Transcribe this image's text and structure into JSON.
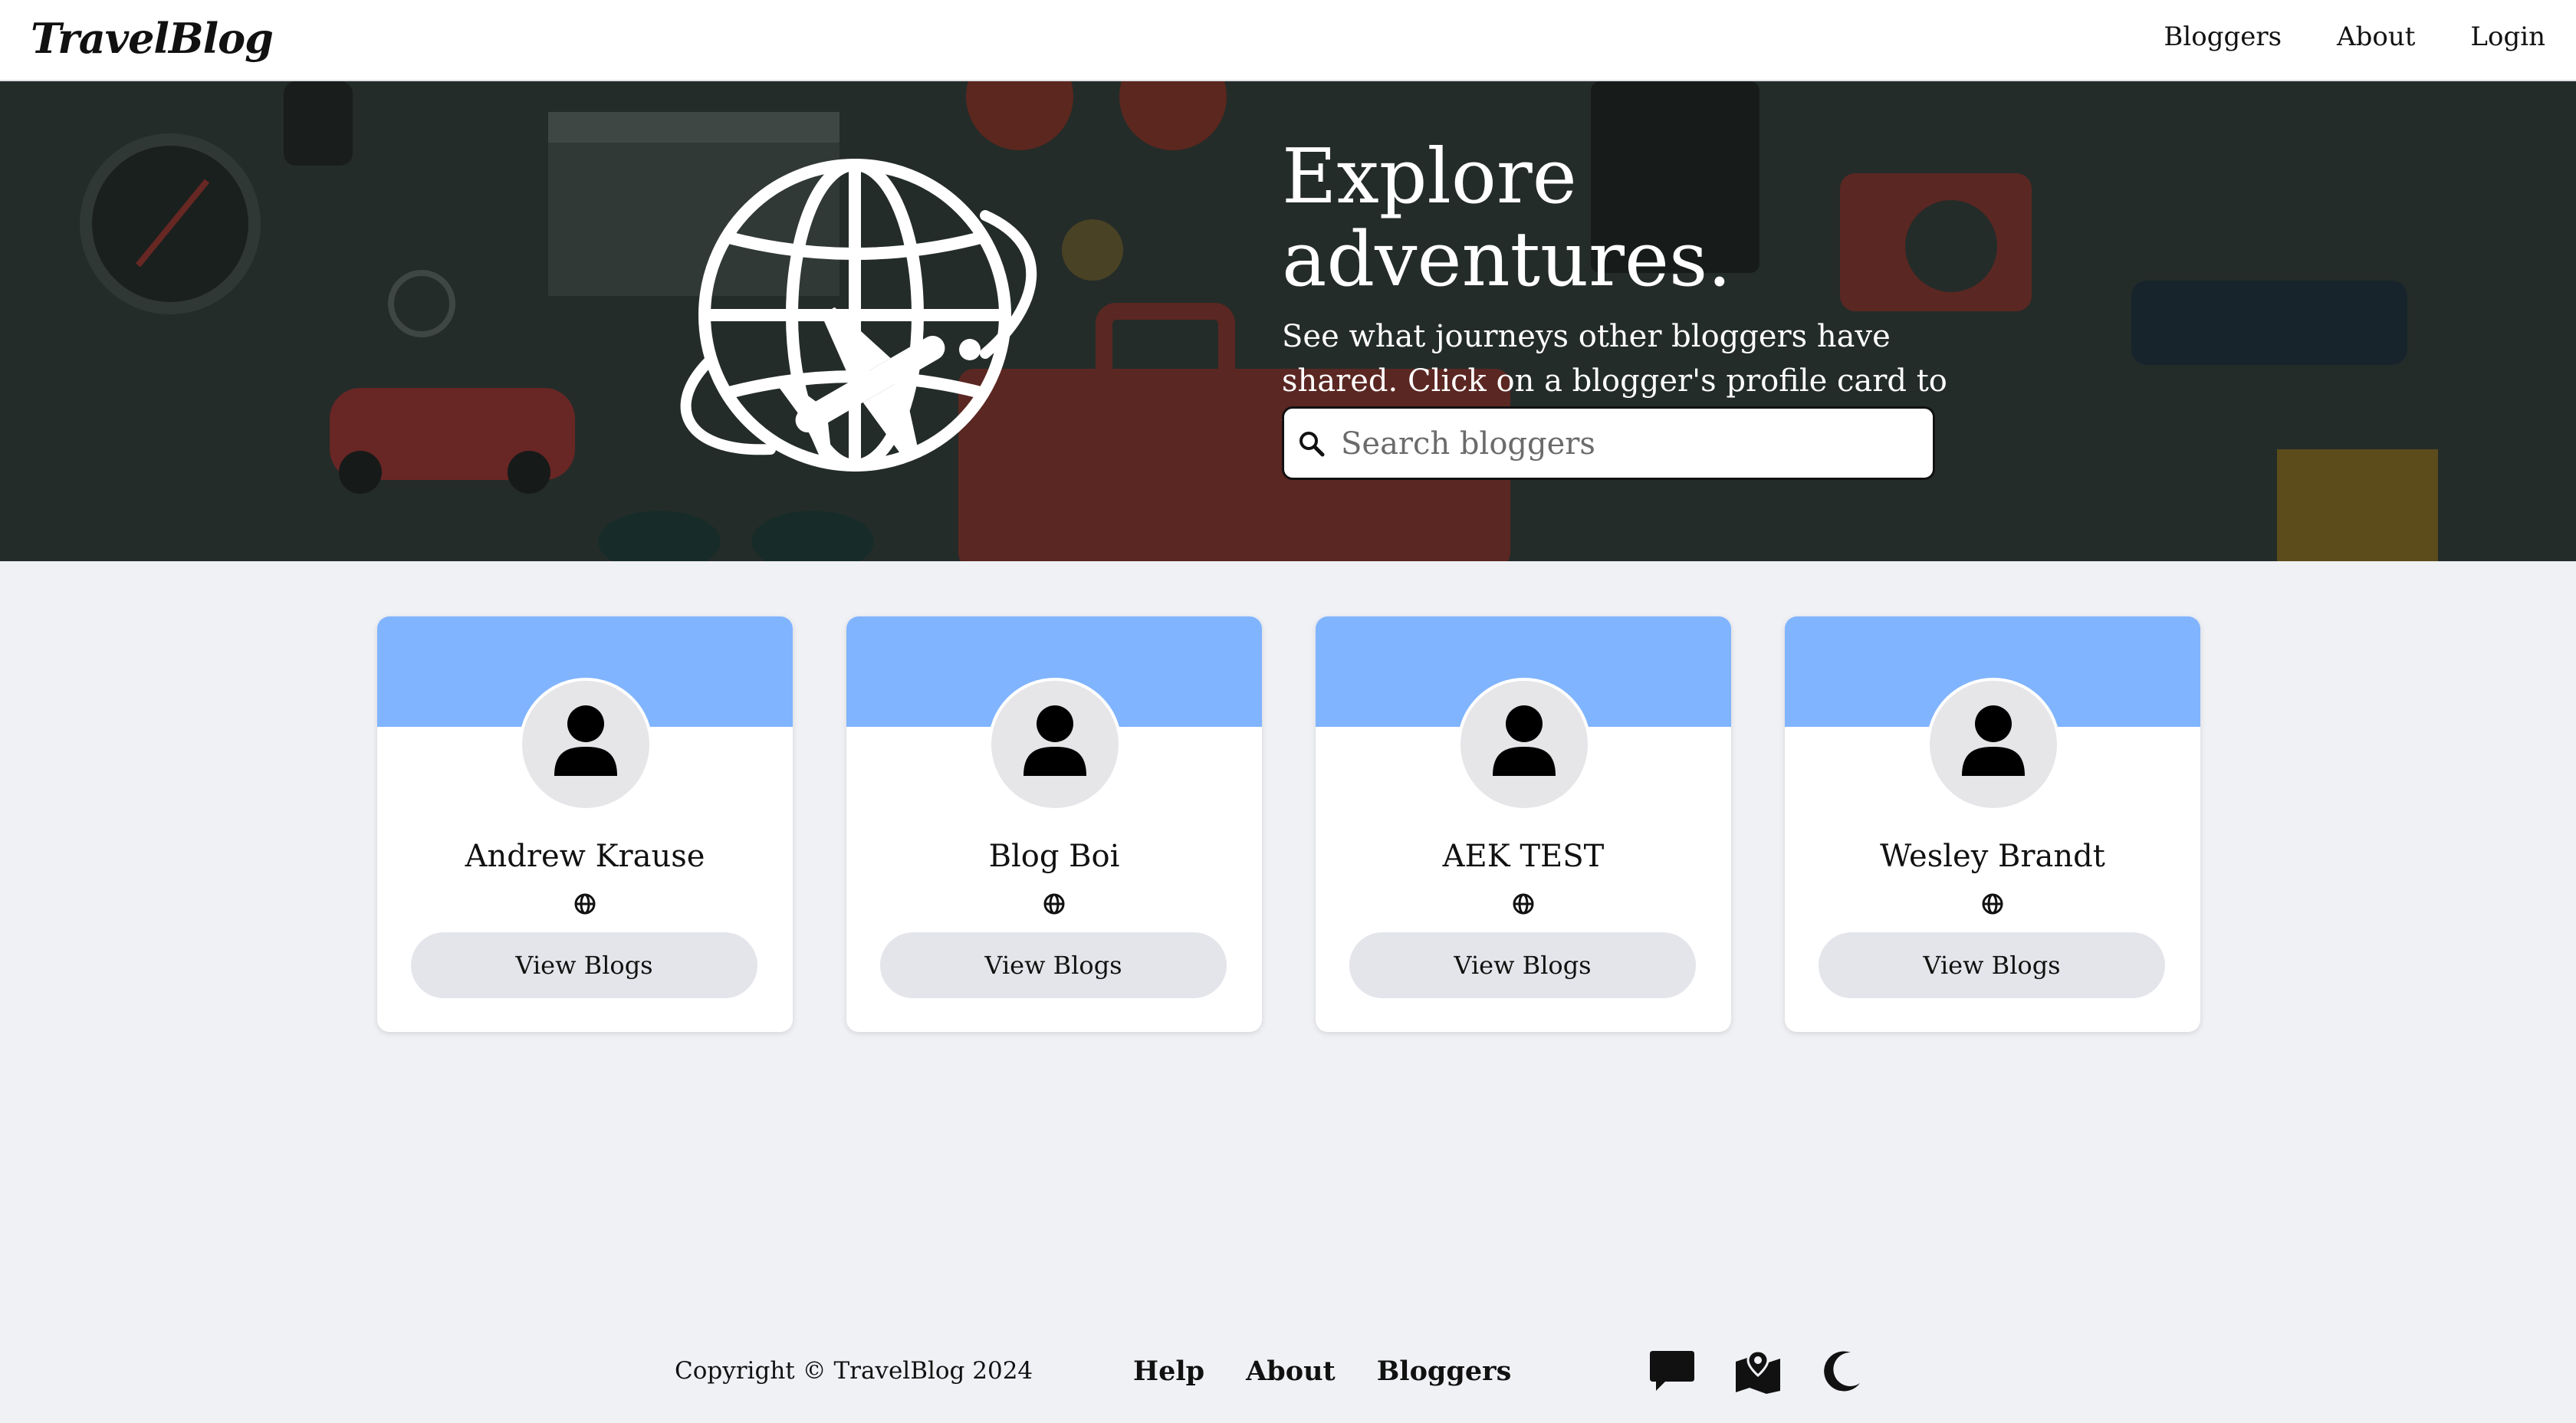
{
  "header": {
    "logo": "TravelBlog",
    "nav": [
      {
        "label": "Bloggers"
      },
      {
        "label": "About"
      },
      {
        "label": "Login"
      }
    ]
  },
  "hero": {
    "title": "Explore adventures.",
    "subtitle": "See what journeys other bloggers have shared. Click on a blogger's profile card to view their content.",
    "search_placeholder": "Search bloggers",
    "search_value": ""
  },
  "bloggers": [
    {
      "name": "Andrew Krause",
      "button": "View Blogs"
    },
    {
      "name": "Blog Boi",
      "button": "View Blogs"
    },
    {
      "name": "AEK TEST",
      "button": "View Blogs"
    },
    {
      "name": "Wesley Brandt",
      "button": "View Blogs"
    }
  ],
  "footer": {
    "copyright": "Copyright © TravelBlog 2024",
    "links": [
      {
        "label": "Help"
      },
      {
        "label": "About"
      },
      {
        "label": "Bloggers"
      }
    ],
    "icons": [
      "chat-icon",
      "map-icon",
      "dark-mode-moon-icon"
    ]
  },
  "colors": {
    "card_banner": "#80b4ff",
    "page_background": "#f0f1f5",
    "button_background": "#e4e5ea"
  }
}
